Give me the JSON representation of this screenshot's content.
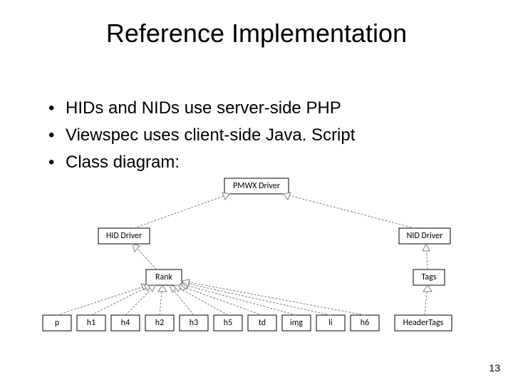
{
  "title": "Reference Implementation",
  "bullets": [
    "HIDs and NIDs use server-side PHP",
    "Viewspec uses client-side Java. Script",
    "Class diagram:"
  ],
  "page_number": "13",
  "diagram": {
    "top": {
      "pmwx": "PMWX Driver",
      "hid": "HID Driver",
      "nid": "NID Driver"
    },
    "mid": {
      "rank": "Rank",
      "tags": "Tags"
    },
    "leaves": [
      "p",
      "h1",
      "h4",
      "h2",
      "h3",
      "h5",
      "td",
      "img",
      "li",
      "h6",
      "HeaderTags"
    ]
  }
}
